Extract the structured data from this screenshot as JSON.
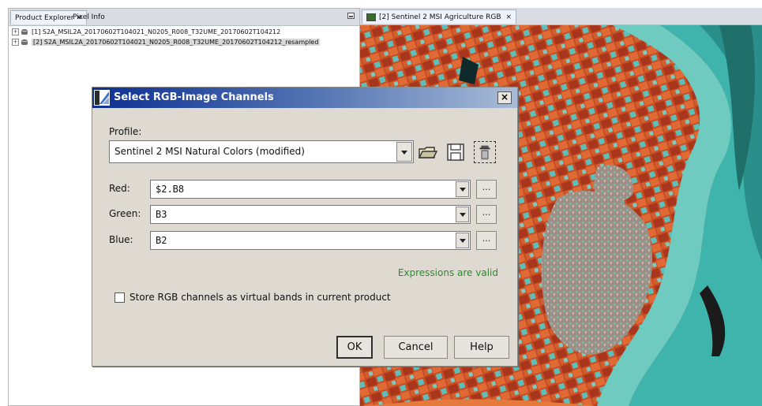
{
  "left_panel": {
    "tabs": [
      {
        "label": "Product Explorer",
        "close": "✕"
      },
      {
        "label": "Pixel Info"
      }
    ],
    "products": [
      {
        "label": "[1] S2A_MSIL2A_20170602T104021_N0205_R008_T32UME_20170602T104212",
        "expander": "+"
      },
      {
        "label": "[2] S2A_MSIL2A_20170602T104021_N0205_R008_T32UME_20170602T104212_resampled",
        "expander": "+"
      }
    ]
  },
  "right_panel": {
    "tab": {
      "label": "[2] Sentinel 2 MSI Agriculture RGB",
      "close": "×"
    }
  },
  "dialog": {
    "title": "Select RGB-Image Channels",
    "close": "×",
    "profile_label": "Profile:",
    "profile_value": "Sentinel 2 MSI Natural Colors (modified)",
    "channels": {
      "red": {
        "label": "Red:",
        "value": "$2.B8"
      },
      "green": {
        "label": "Green:",
        "value": "B3"
      },
      "blue": {
        "label": "Blue:",
        "value": "B2"
      }
    },
    "edit_label": "...",
    "status": "Expressions are valid",
    "virtual_bands_label": "Store RGB channels as virtual bands in current product",
    "virtual_bands_checked": false,
    "buttons": {
      "ok": "OK",
      "cancel": "Cancel",
      "help": "Help"
    }
  },
  "colors": {
    "title_gradient_start": "#0c2f93",
    "status_green": "#2c8a2c",
    "land": "#c84d25",
    "water": "#3fb4ad"
  }
}
